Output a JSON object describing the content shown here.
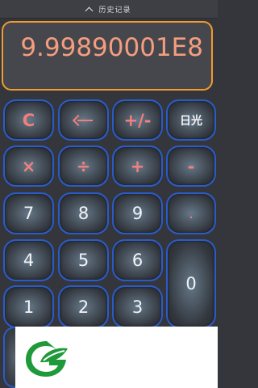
{
  "history": {
    "label": "历史记录"
  },
  "display": {
    "value": "9.99890001E8"
  },
  "keys": {
    "clear": "C",
    "sign": "+/-",
    "daylight": "日光",
    "multiply": "×",
    "divide": "÷",
    "add": "+",
    "subtract": "-",
    "seven": "7",
    "eight": "8",
    "nine": "9",
    "dot": ".",
    "four": "4",
    "five": "5",
    "six": "6",
    "zero": "0",
    "one": "1",
    "two": "2",
    "three": "3"
  },
  "colors": {
    "accent_orange": "#f29b2f",
    "key_border_blue": "#2a5cc9",
    "operator_red": "#f07f7d",
    "ad_logo_green": "#1e9a3a"
  },
  "icons": {
    "backspace": "left-arrow-icon",
    "history": "chevron-up-icon",
    "ad_logo": "leaf-g-logo"
  }
}
